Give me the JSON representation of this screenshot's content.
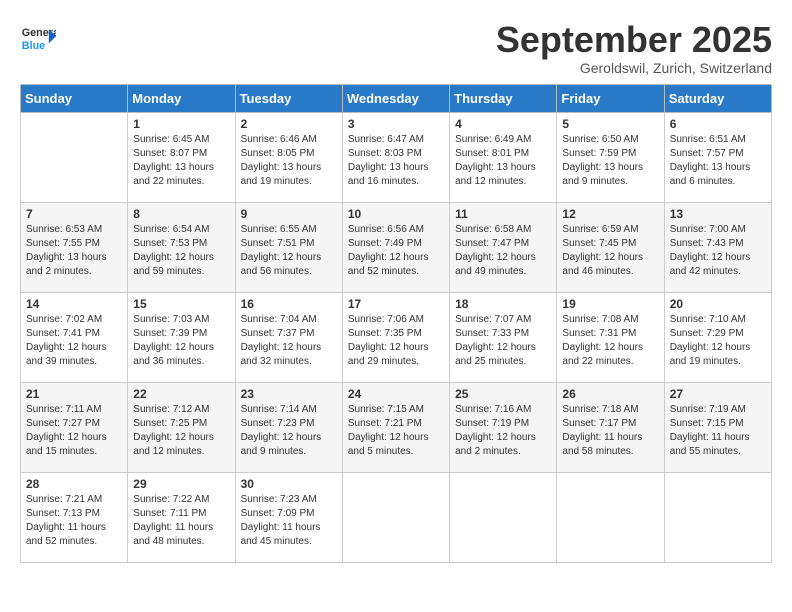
{
  "header": {
    "logo_general": "General",
    "logo_blue": "Blue",
    "month": "September 2025",
    "location": "Geroldswil, Zurich, Switzerland"
  },
  "weekdays": [
    "Sunday",
    "Monday",
    "Tuesday",
    "Wednesday",
    "Thursday",
    "Friday",
    "Saturday"
  ],
  "weeks": [
    [
      {
        "day": "",
        "info": ""
      },
      {
        "day": "1",
        "info": "Sunrise: 6:45 AM\nSunset: 8:07 PM\nDaylight: 13 hours\nand 22 minutes."
      },
      {
        "day": "2",
        "info": "Sunrise: 6:46 AM\nSunset: 8:05 PM\nDaylight: 13 hours\nand 19 minutes."
      },
      {
        "day": "3",
        "info": "Sunrise: 6:47 AM\nSunset: 8:03 PM\nDaylight: 13 hours\nand 16 minutes."
      },
      {
        "day": "4",
        "info": "Sunrise: 6:49 AM\nSunset: 8:01 PM\nDaylight: 13 hours\nand 12 minutes."
      },
      {
        "day": "5",
        "info": "Sunrise: 6:50 AM\nSunset: 7:59 PM\nDaylight: 13 hours\nand 9 minutes."
      },
      {
        "day": "6",
        "info": "Sunrise: 6:51 AM\nSunset: 7:57 PM\nDaylight: 13 hours\nand 6 minutes."
      }
    ],
    [
      {
        "day": "7",
        "info": "Sunrise: 6:53 AM\nSunset: 7:55 PM\nDaylight: 13 hours\nand 2 minutes."
      },
      {
        "day": "8",
        "info": "Sunrise: 6:54 AM\nSunset: 7:53 PM\nDaylight: 12 hours\nand 59 minutes."
      },
      {
        "day": "9",
        "info": "Sunrise: 6:55 AM\nSunset: 7:51 PM\nDaylight: 12 hours\nand 56 minutes."
      },
      {
        "day": "10",
        "info": "Sunrise: 6:56 AM\nSunset: 7:49 PM\nDaylight: 12 hours\nand 52 minutes."
      },
      {
        "day": "11",
        "info": "Sunrise: 6:58 AM\nSunset: 7:47 PM\nDaylight: 12 hours\nand 49 minutes."
      },
      {
        "day": "12",
        "info": "Sunrise: 6:59 AM\nSunset: 7:45 PM\nDaylight: 12 hours\nand 46 minutes."
      },
      {
        "day": "13",
        "info": "Sunrise: 7:00 AM\nSunset: 7:43 PM\nDaylight: 12 hours\nand 42 minutes."
      }
    ],
    [
      {
        "day": "14",
        "info": "Sunrise: 7:02 AM\nSunset: 7:41 PM\nDaylight: 12 hours\nand 39 minutes."
      },
      {
        "day": "15",
        "info": "Sunrise: 7:03 AM\nSunset: 7:39 PM\nDaylight: 12 hours\nand 36 minutes."
      },
      {
        "day": "16",
        "info": "Sunrise: 7:04 AM\nSunset: 7:37 PM\nDaylight: 12 hours\nand 32 minutes."
      },
      {
        "day": "17",
        "info": "Sunrise: 7:06 AM\nSunset: 7:35 PM\nDaylight: 12 hours\nand 29 minutes."
      },
      {
        "day": "18",
        "info": "Sunrise: 7:07 AM\nSunset: 7:33 PM\nDaylight: 12 hours\nand 25 minutes."
      },
      {
        "day": "19",
        "info": "Sunrise: 7:08 AM\nSunset: 7:31 PM\nDaylight: 12 hours\nand 22 minutes."
      },
      {
        "day": "20",
        "info": "Sunrise: 7:10 AM\nSunset: 7:29 PM\nDaylight: 12 hours\nand 19 minutes."
      }
    ],
    [
      {
        "day": "21",
        "info": "Sunrise: 7:11 AM\nSunset: 7:27 PM\nDaylight: 12 hours\nand 15 minutes."
      },
      {
        "day": "22",
        "info": "Sunrise: 7:12 AM\nSunset: 7:25 PM\nDaylight: 12 hours\nand 12 minutes."
      },
      {
        "day": "23",
        "info": "Sunrise: 7:14 AM\nSunset: 7:23 PM\nDaylight: 12 hours\nand 9 minutes."
      },
      {
        "day": "24",
        "info": "Sunrise: 7:15 AM\nSunset: 7:21 PM\nDaylight: 12 hours\nand 5 minutes."
      },
      {
        "day": "25",
        "info": "Sunrise: 7:16 AM\nSunset: 7:19 PM\nDaylight: 12 hours\nand 2 minutes."
      },
      {
        "day": "26",
        "info": "Sunrise: 7:18 AM\nSunset: 7:17 PM\nDaylight: 11 hours\nand 58 minutes."
      },
      {
        "day": "27",
        "info": "Sunrise: 7:19 AM\nSunset: 7:15 PM\nDaylight: 11 hours\nand 55 minutes."
      }
    ],
    [
      {
        "day": "28",
        "info": "Sunrise: 7:21 AM\nSunset: 7:13 PM\nDaylight: 11 hours\nand 52 minutes."
      },
      {
        "day": "29",
        "info": "Sunrise: 7:22 AM\nSunset: 7:11 PM\nDaylight: 11 hours\nand 48 minutes."
      },
      {
        "day": "30",
        "info": "Sunrise: 7:23 AM\nSunset: 7:09 PM\nDaylight: 11 hours\nand 45 minutes."
      },
      {
        "day": "",
        "info": ""
      },
      {
        "day": "",
        "info": ""
      },
      {
        "day": "",
        "info": ""
      },
      {
        "day": "",
        "info": ""
      }
    ]
  ]
}
